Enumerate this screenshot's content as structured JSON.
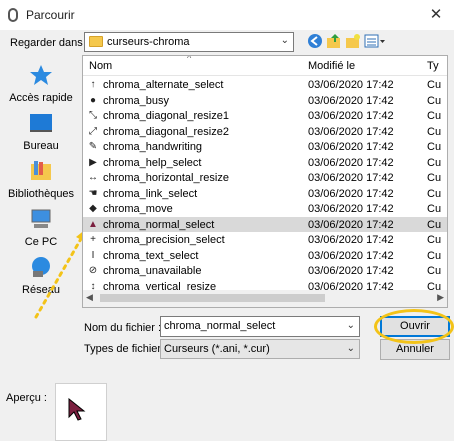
{
  "window": {
    "title": "Parcourir",
    "close_symbol": "✕"
  },
  "lookin": {
    "label": "Regarder dans :",
    "value": "curseurs-chroma"
  },
  "places": [
    {
      "name": "quick-access",
      "label": "Accès rapide"
    },
    {
      "name": "desktop",
      "label": "Bureau"
    },
    {
      "name": "libraries",
      "label": "Bibliothèques"
    },
    {
      "name": "this-pc",
      "label": "Ce PC"
    },
    {
      "name": "network",
      "label": "Réseau"
    }
  ],
  "columns": {
    "name": "Nom",
    "modified": "Modifié le",
    "type": "Ty"
  },
  "files": [
    {
      "name": "chroma_alternate_select",
      "date": "03/06/2020 17:42",
      "type": "Cu",
      "icon": "↑"
    },
    {
      "name": "chroma_busy",
      "date": "03/06/2020 17:42",
      "type": "Cu",
      "icon": "●"
    },
    {
      "name": "chroma_diagonal_resize1",
      "date": "03/06/2020 17:42",
      "type": "Cu",
      "icon": "⤡"
    },
    {
      "name": "chroma_diagonal_resize2",
      "date": "03/06/2020 17:42",
      "type": "Cu",
      "icon": "⤢"
    },
    {
      "name": "chroma_handwriting",
      "date": "03/06/2020 17:42",
      "type": "Cu",
      "icon": "✎"
    },
    {
      "name": "chroma_help_select",
      "date": "03/06/2020 17:42",
      "type": "Cu",
      "icon": "▶"
    },
    {
      "name": "chroma_horizontal_resize",
      "date": "03/06/2020 17:42",
      "type": "Cu",
      "icon": "↔"
    },
    {
      "name": "chroma_link_select",
      "date": "03/06/2020 17:42",
      "type": "Cu",
      "icon": "☚"
    },
    {
      "name": "chroma_move",
      "date": "03/06/2020 17:42",
      "type": "Cu",
      "icon": "◆"
    },
    {
      "name": "chroma_normal_select",
      "date": "03/06/2020 17:42",
      "type": "Cu",
      "icon": "▲",
      "selected": true
    },
    {
      "name": "chroma_precision_select",
      "date": "03/06/2020 17:42",
      "type": "Cu",
      "icon": "+"
    },
    {
      "name": "chroma_text_select",
      "date": "03/06/2020 17:42",
      "type": "Cu",
      "icon": "I"
    },
    {
      "name": "chroma_unavailable",
      "date": "03/06/2020 17:42",
      "type": "Cu",
      "icon": "⊘"
    },
    {
      "name": "chroma_vertical_resize",
      "date": "03/06/2020 17:42",
      "type": "Cu",
      "icon": "↕"
    }
  ],
  "filename": {
    "label": "Nom du fichier :",
    "value": "chroma_normal_select"
  },
  "filetype": {
    "label": "Types de fichiers :",
    "value": "Curseurs (*.ani, *.cur)"
  },
  "buttons": {
    "open": "Ouvrir",
    "cancel": "Annuler"
  },
  "preview": {
    "label": "Aperçu :"
  },
  "colors": {
    "accent": "#0078d7",
    "highlight": "#f3c318",
    "selected_row": "#d9d9d9",
    "cursor": "#7b1f3f"
  }
}
